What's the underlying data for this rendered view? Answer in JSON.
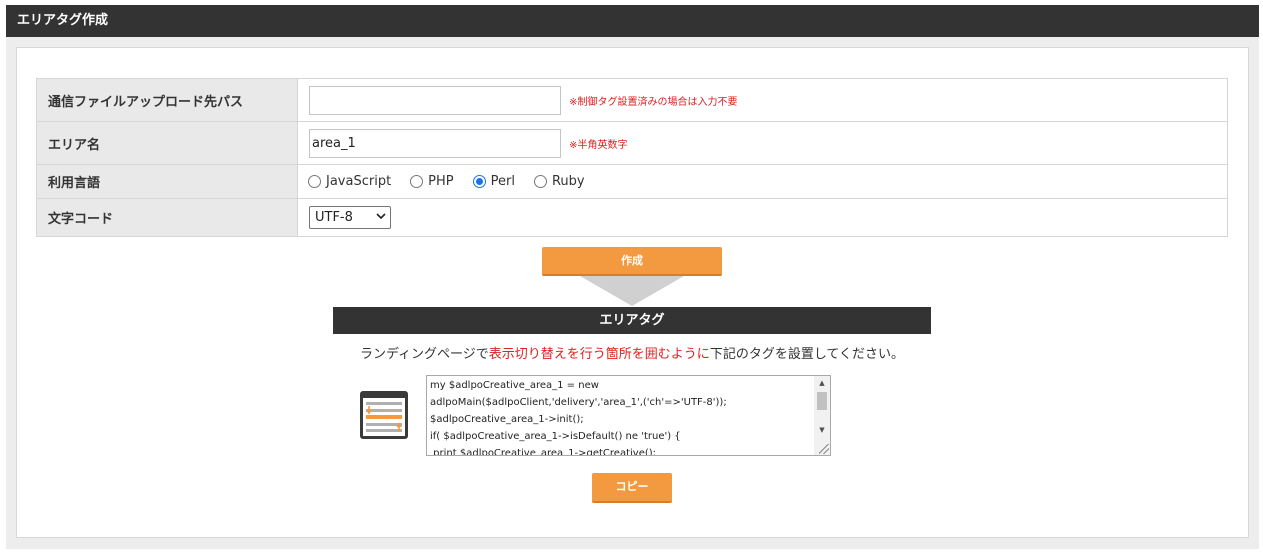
{
  "panel": {
    "title": "エリアタグ作成"
  },
  "form": {
    "upload_path": {
      "label": "通信ファイルアップロード先パス",
      "value": "",
      "note": "※制御タグ設置済みの場合は入力不要"
    },
    "area_name": {
      "label": "エリア名",
      "value": "area_1",
      "note": "※半角英数字"
    },
    "language": {
      "label": "利用言語",
      "options": [
        "JavaScript",
        "PHP",
        "Perl",
        "Ruby"
      ],
      "selected": "Perl"
    },
    "charset": {
      "label": "文字コード",
      "value": "UTF-8"
    }
  },
  "actions": {
    "create_label": "作成",
    "copy_label": "コピー"
  },
  "result": {
    "title": "エリアタグ",
    "instruction_before": "ランディングページで",
    "instruction_highlight": "表示切り替えを行う箇所を囲むように",
    "instruction_after": "下記のタグを設置してください。",
    "code_lines": [
      "my $adlpoCreative_area_1 = new",
      "adlpoMain($adlpoClient,'delivery','area_1',('ch'=>'UTF-8'));",
      "$adlpoCreative_area_1->init();",
      "if( $adlpoCreative_area_1->isDefault() ne 'true') {",
      " print $adlpoCreative_area_1->getCreative();"
    ]
  },
  "colors": {
    "header_bg": "#333333",
    "accent_orange": "#f39a40",
    "note_red": "#e12020",
    "radio_blue": "#1a73e8"
  }
}
